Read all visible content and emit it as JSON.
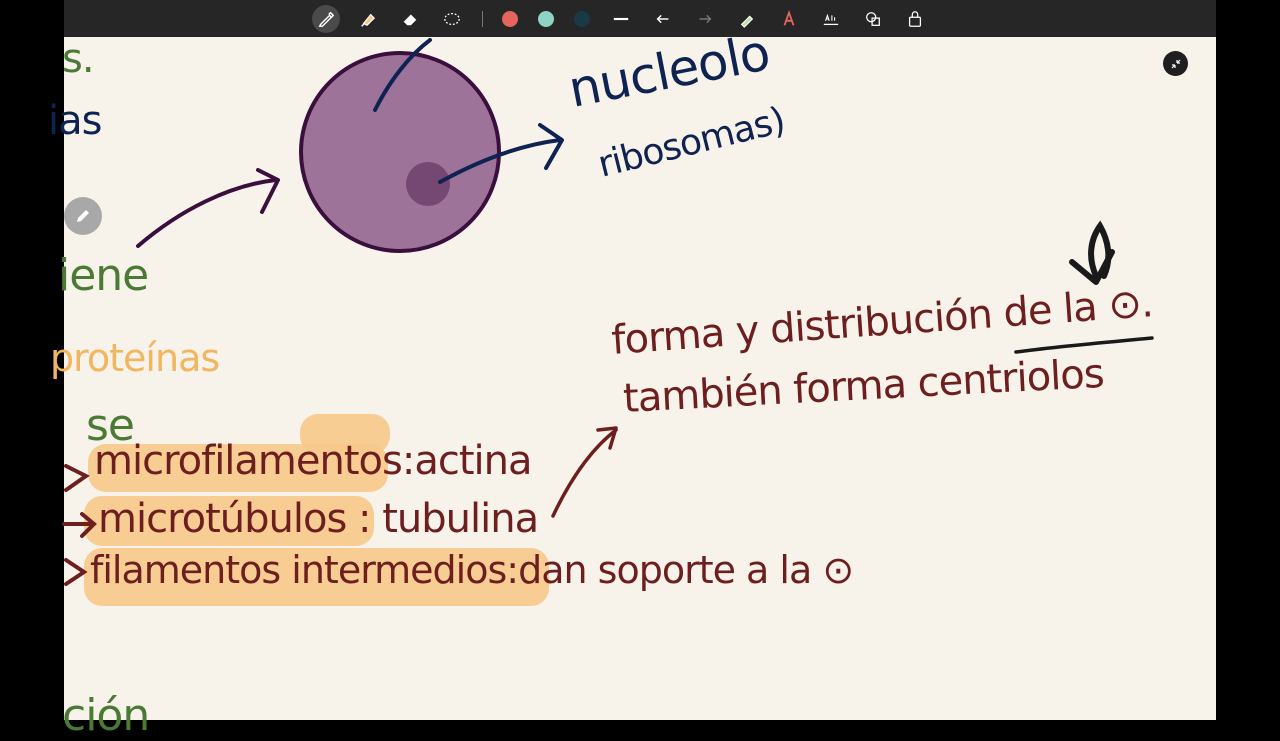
{
  "toolbar": {
    "tools": [
      {
        "name": "pen-tool-icon",
        "active": true
      },
      {
        "name": "highlighter-tool-icon"
      },
      {
        "name": "eraser-tool-icon"
      },
      {
        "name": "lasso-tool-icon"
      }
    ],
    "colors": [
      "#e5645c",
      "#8fd3c4",
      "#173a45"
    ],
    "actions": [
      "stroke-width-icon",
      "undo-icon",
      "redo-icon",
      "shape-pen-icon",
      "text-style-icon",
      "text-box-icon",
      "shapes-icon",
      "lock-icon"
    ]
  },
  "notes": {
    "left_fragments": {
      "s_dot": "s.",
      "ias": "ias",
      "iene": "iene",
      "proteinas": "proteínas",
      "se": "se",
      "cion": "ción"
    },
    "nucleolo": "nucleolo",
    "ribosomas": "ribosomas)",
    "line1": {
      "term": "microfilamentos",
      "sep": ":",
      "value": "actina"
    },
    "line2": {
      "term": "microtúbulos",
      "sep": ":",
      "value": "tubulina"
    },
    "line3": {
      "term": "filamentos intermedios",
      "sep": ":",
      "value": "dan soporte a la ⊙"
    },
    "forma": "forma y distribución de la ⊙.",
    "tambien": "también forma centriolos"
  }
}
